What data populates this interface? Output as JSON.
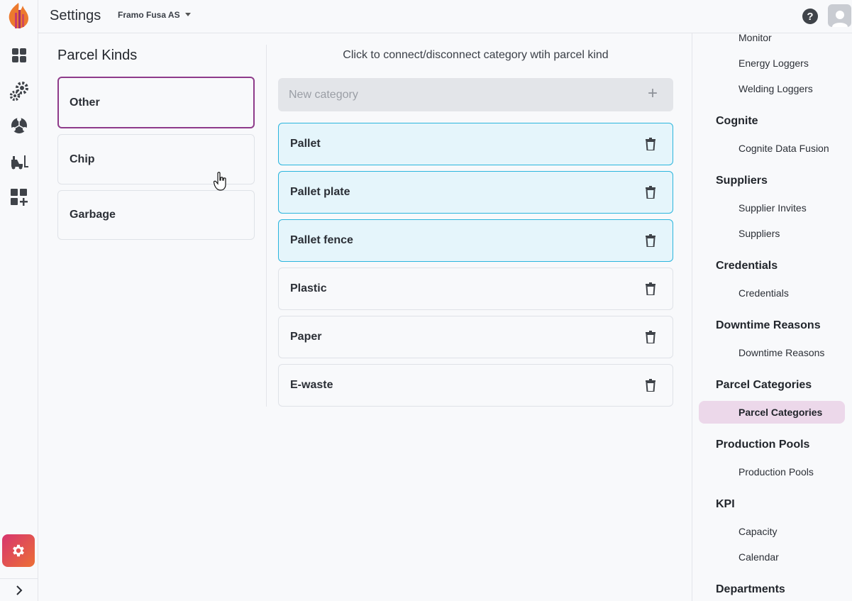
{
  "header": {
    "title": "Settings",
    "organization": "Framo Fusa AS"
  },
  "parcel_kinds": {
    "title": "Parcel Kinds",
    "items": [
      {
        "label": "Other",
        "selected": true
      },
      {
        "label": "Chip",
        "selected": false
      },
      {
        "label": "Garbage",
        "selected": false
      }
    ]
  },
  "categories": {
    "instruction": "Click to connect/disconnect category wtih parcel kind",
    "new_placeholder": "New category",
    "items": [
      {
        "label": "Pallet",
        "linked": true
      },
      {
        "label": "Pallet plate",
        "linked": true
      },
      {
        "label": "Pallet fence",
        "linked": true
      },
      {
        "label": "Plastic",
        "linked": false
      },
      {
        "label": "Paper",
        "linked": false
      },
      {
        "label": "E-waste",
        "linked": false
      }
    ]
  },
  "right_nav": {
    "monitor": "Monitor",
    "energy_loggers": "Energy Loggers",
    "welding_loggers": "Welding Loggers",
    "cognite": "Cognite",
    "cognite_data_fusion": "Cognite Data Fusion",
    "suppliers_head": "Suppliers",
    "supplier_invites": "Supplier Invites",
    "suppliers": "Suppliers",
    "credentials_head": "Credentials",
    "credentials": "Credentials",
    "downtime_head": "Downtime Reasons",
    "downtime": "Downtime Reasons",
    "parcel_categories_head": "Parcel Categories",
    "parcel_categories": "Parcel Categories",
    "production_pools_head": "Production Pools",
    "production_pools": "Production Pools",
    "kpi": "KPI",
    "capacity": "Capacity",
    "calendar": "Calendar",
    "departments": "Departments"
  },
  "colors": {
    "selected_border": "#8e3b8a",
    "linked_bg": "#e5f5fb",
    "linked_border": "#2bb5dd",
    "active_nav_bg": "#ecd8ea"
  },
  "icons": {
    "rail": [
      "dashboard-icon",
      "gears-icon",
      "network-icon",
      "forklift-icon",
      "add-widget-icon",
      "settings-icon",
      "chevron-right-icon"
    ],
    "top": [
      "help-icon",
      "user-icon",
      "caret-down-icon"
    ],
    "row": "trash-icon",
    "input": "plus-icon"
  }
}
